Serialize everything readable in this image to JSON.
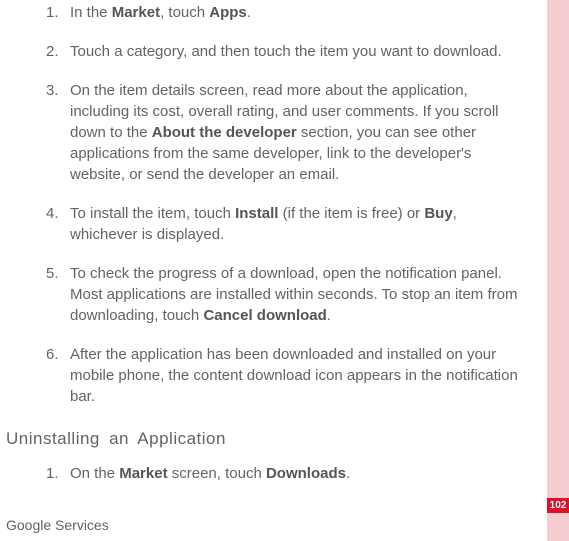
{
  "steps_main": [
    {
      "num": "1.",
      "parts": [
        {
          "t": "In the ",
          "b": false
        },
        {
          "t": "Market",
          "b": true
        },
        {
          "t": ", touch ",
          "b": false
        },
        {
          "t": "Apps",
          "b": true
        },
        {
          "t": ".",
          "b": false
        }
      ]
    },
    {
      "num": "2.",
      "parts": [
        {
          "t": "Touch a category, and then touch the item you want to download.",
          "b": false
        }
      ]
    },
    {
      "num": "3.",
      "parts": [
        {
          "t": "On the item details screen, read more about the application, including its cost, overall rating, and user comments. If you scroll down to the ",
          "b": false
        },
        {
          "t": "About the developer",
          "b": true
        },
        {
          "t": " section, you can see other applications from the same developer, link to the developer's website, or send the developer an email.",
          "b": false
        }
      ]
    },
    {
      "num": "4.",
      "parts": [
        {
          "t": "To install the item, touch ",
          "b": false
        },
        {
          "t": "Install",
          "b": true
        },
        {
          "t": " (if the item is free) or ",
          "b": false
        },
        {
          "t": "Buy",
          "b": true
        },
        {
          "t": ", whichever is displayed.",
          "b": false
        }
      ]
    },
    {
      "num": "5.",
      "parts": [
        {
          "t": "To check the progress of a download, open the notification panel. Most applications are installed within seconds. To stop an item from downloading, touch ",
          "b": false
        },
        {
          "t": "Cancel download",
          "b": true
        },
        {
          "t": ".",
          "b": false
        }
      ]
    },
    {
      "num": "6.",
      "parts": [
        {
          "t": "After the application has been downloaded and installed on your mobile phone, the content download icon appears in the notification bar.",
          "b": false
        }
      ]
    }
  ],
  "section_heading": "Uninstalling an Application",
  "steps_sub": [
    {
      "num": "1.",
      "parts": [
        {
          "t": "On the ",
          "b": false
        },
        {
          "t": "Market",
          "b": true
        },
        {
          "t": " screen, touch ",
          "b": false
        },
        {
          "t": "Downloads",
          "b": true
        },
        {
          "t": ".",
          "b": false
        }
      ]
    }
  ],
  "footer": "Google Services",
  "page_number": "102"
}
